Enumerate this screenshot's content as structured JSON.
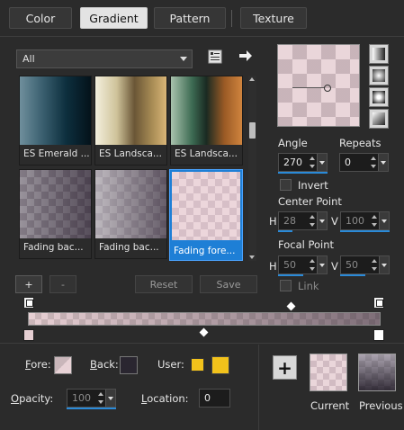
{
  "tabs": [
    {
      "label": "Color",
      "active": false
    },
    {
      "label": "Gradient",
      "active": true
    },
    {
      "label": "Pattern",
      "active": false
    },
    {
      "label": "Texture",
      "active": false
    }
  ],
  "library": {
    "filter_value": "All",
    "items": [
      {
        "label": "ES Emerald ...",
        "selected": false
      },
      {
        "label": "ES Landsca...",
        "selected": false
      },
      {
        "label": "ES Landsca...",
        "selected": false
      },
      {
        "label": "Fading bac...",
        "selected": false
      },
      {
        "label": "Fading bac...",
        "selected": false
      },
      {
        "label": "Fading fore...",
        "selected": true
      }
    ],
    "add_label": "+",
    "remove_label": "-",
    "reset_label": "Reset",
    "save_label": "Save"
  },
  "settings": {
    "angle_label": "Angle",
    "angle_value": "270",
    "repeats_label": "Repeats",
    "repeats_value": "0",
    "invert_label": "Invert",
    "center_point_label": "Center Point",
    "center_h_label": "H",
    "center_h_value": "28",
    "center_v_label": "V",
    "center_v_value": "100",
    "focal_point_label": "Focal Point",
    "focal_h_label": "H",
    "focal_h_value": "50",
    "focal_v_label": "V",
    "focal_v_value": "50",
    "link_label": "Link"
  },
  "stop_props": {
    "fore_label": "Fore:",
    "back_label": "Back:",
    "user_label": "User:",
    "opacity_label": "Opacity:",
    "opacity_value": "100",
    "location_label": "Location:",
    "location_value": "0"
  },
  "swatches": {
    "add_label": "+",
    "current_label": "Current",
    "previous_label": "Previous",
    "user_color": "#f2c21b",
    "accent": "#1e7fd6"
  }
}
